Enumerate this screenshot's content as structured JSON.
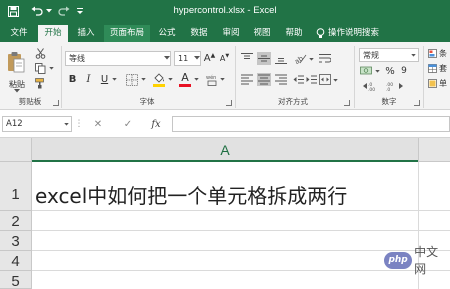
{
  "window": {
    "title": "hypercontrol.xlsx  -  Excel"
  },
  "quick_access": {
    "save_icon": "save-icon",
    "undo_icon": "undo-icon",
    "redo_icon": "redo-icon",
    "customize_icon": "chevron-down-icon"
  },
  "tabs": [
    {
      "label": "文件"
    },
    {
      "label": "开始"
    },
    {
      "label": "插入"
    },
    {
      "label": "页面布局"
    },
    {
      "label": "公式"
    },
    {
      "label": "数据"
    },
    {
      "label": "审阅"
    },
    {
      "label": "视图"
    },
    {
      "label": "帮助"
    }
  ],
  "tell_me": {
    "label": "操作说明搜索"
  },
  "ribbon": {
    "clipboard": {
      "paste_label": "粘贴",
      "group_label": "剪贴板"
    },
    "font": {
      "font_name": "等线",
      "font_size": "11",
      "bold": "B",
      "italic": "I",
      "underline": "U",
      "grow": "A",
      "shrink": "A",
      "font_color_letter": "A",
      "group_label": "字体"
    },
    "alignment": {
      "group_label": "对齐方式"
    },
    "number": {
      "format": "常规",
      "percent": "%",
      "comma": "9",
      "group_label": "数字"
    },
    "styles": {
      "cond_label": "条",
      "table_label": "套",
      "cell_label": "单"
    }
  },
  "formula_bar": {
    "name_box": "A12",
    "fx": "fx",
    "cancel": "✕",
    "enter": "✓",
    "value": ""
  },
  "grid": {
    "column_header": "A",
    "rows": [
      "1",
      "2",
      "3",
      "4",
      "5"
    ],
    "a1": "excel中如何把一个单元格拆成两行"
  },
  "watermark": {
    "logo": "php",
    "text": "中文网"
  },
  "colors": {
    "excel_green": "#217346",
    "ribbon_bg": "#f3f3f3",
    "font_red": "#e81123",
    "fill_yellow": "#ffd200"
  }
}
